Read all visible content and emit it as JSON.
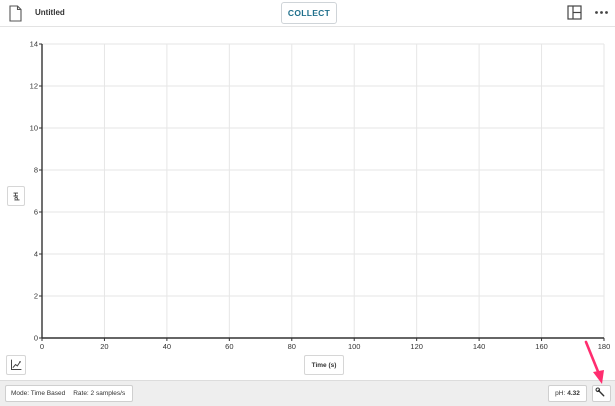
{
  "toolbar": {
    "document_title": "Untitled",
    "collect_label": "COLLECT",
    "icons": [
      "file-icon",
      "layout-icon",
      "more-icon"
    ]
  },
  "graph": {
    "y_axis_label": "pH",
    "x_axis_label": "Time (s)",
    "tools_icon": "graph-tools-icon"
  },
  "chart_data": {
    "type": "line",
    "series": [],
    "xlabel": "Time (s)",
    "ylabel": "pH",
    "xlim": [
      0,
      180
    ],
    "ylim": [
      0,
      14
    ],
    "x_ticks": [
      0,
      20,
      40,
      60,
      80,
      100,
      120,
      140,
      160,
      180
    ],
    "y_ticks": [
      0,
      2,
      4,
      6,
      8,
      10,
      12,
      14
    ],
    "grid": true,
    "axis_color": "#333333",
    "grid_color": "#e6e6e6"
  },
  "status": {
    "mode_label": "Mode: Time Based",
    "rate_label": "Rate: 2 samples/s",
    "meter_label": "pH:",
    "meter_value": "4.32",
    "sensor_icon": "wrench-icon",
    "annotation_color": "#ff2d6f"
  },
  "colors": {
    "accent": "#1f6f8b",
    "statusbar_bg": "#eeeeee"
  }
}
